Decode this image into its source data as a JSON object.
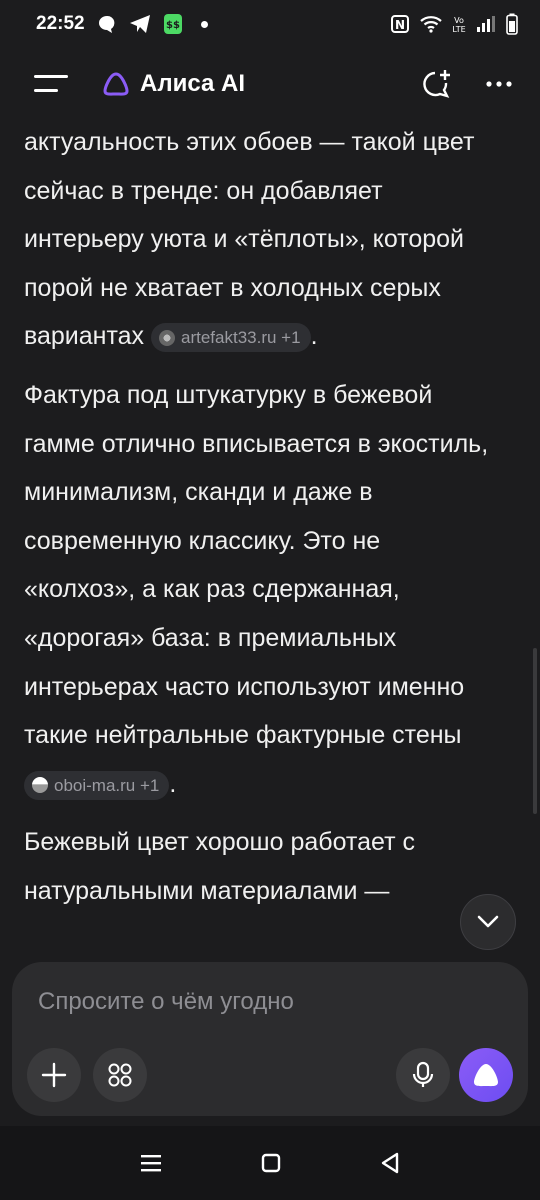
{
  "status_bar": {
    "time": "22:52",
    "icons": [
      "chat-bubble-icon",
      "telegram-icon",
      "app-icon",
      "dot-icon",
      "nfc-icon",
      "wifi-icon",
      "volte-icon",
      "signal-icon",
      "battery-icon"
    ]
  },
  "header": {
    "menu_icon": "hamburger-icon",
    "title": "Алиса AI",
    "new_chat_icon": "new-chat-icon",
    "more_icon": "more-icon"
  },
  "content": {
    "paragraphs": [
      {
        "text": "актуальность этих обоев — такой цвет сейчас в тренде: он добавляет интерьеру уюта и «тёплоты», которой порой не хватает в холодных серых вариантах",
        "source": "artefakt33.ru +1",
        "tail": "."
      },
      {
        "text": "Фактура под штукатурку в бежевой гамме отлично вписывается в экостиль, минимализм, сканди и даже в современную классику. Это не «колхоз», а как раз сдержанная, «дорогая» база: в премиальных интерьерах часто используют именно такие нейтральные фактурные стены",
        "source": "oboi-ma.ru +1",
        "tail": "."
      },
      {
        "text": "Бежевый цвет хорошо работает с натуральными материалами —"
      }
    ]
  },
  "composer": {
    "placeholder": "Спросите о чём угодно"
  },
  "colors": {
    "background": "#1c1c1e",
    "accent": "#7c5cf5"
  }
}
